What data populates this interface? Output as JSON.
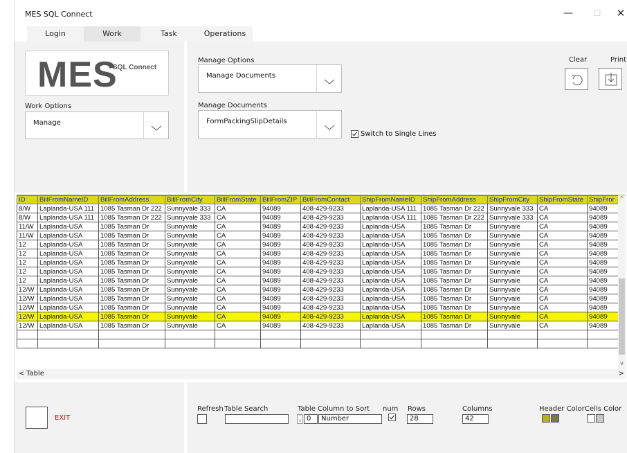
{
  "window": {
    "title": "MES SQL Connect",
    "min_label": "—",
    "max_label": "☐",
    "close_label": "✕"
  },
  "tabs": [
    {
      "label": "Login"
    },
    {
      "label": "Work"
    },
    {
      "label": "Task"
    },
    {
      "label": "Operations"
    }
  ],
  "logo": {
    "big": "MES",
    "small": "SQL Connect"
  },
  "work_options": {
    "label": "Work Options",
    "value": "Manage"
  },
  "manage_options": {
    "label": "Manage Options",
    "value": "Manage Documents"
  },
  "manage_documents": {
    "label": "Manage Documents",
    "value": "FormPackingSlipDetails"
  },
  "single_lines": {
    "label": "Switch to Single Lines",
    "checked": true
  },
  "toolbar": {
    "clear_label": "Clear",
    "print_label": "Print"
  },
  "grid": {
    "columns": [
      "ID",
      "BillFromNameID",
      "BillFromAddress",
      "BillFromCity",
      "BillFromState",
      "BillFromZIP",
      "BillFromContact",
      "ShipFromNameID",
      "ShipFromAddress",
      "ShipFromCity",
      "ShipFromState",
      "ShipFror"
    ],
    "rows": [
      [
        "8/W",
        "Laplanda-USA 111",
        "1085 Tasman Dr 222",
        "Sunnyvale 333",
        "CA",
        "94089",
        "408-429-9233",
        "Laplanda-USA 111",
        "1085 Tasman Dr 222",
        "Sunnyvale 333",
        "CA",
        "94089"
      ],
      [
        "8/W",
        "Laplanda-USA 111",
        "1085 Tasman Dr 222",
        "Sunnyvale 333",
        "CA",
        "94089",
        "408-429-9233",
        "Laplanda-USA 111",
        "1085 Tasman Dr 222",
        "Sunnyvale 333",
        "CA",
        "94089"
      ],
      [
        "11/W",
        "Laplanda-USA",
        "1085 Tasman Dr",
        "Sunnyvale",
        "CA",
        "94089",
        "408-429-9233",
        "Laplanda-USA",
        "1085 Tasman Dr",
        "Sunnyvale",
        "CA",
        "94089"
      ],
      [
        "11/W",
        "Laplanda-USA",
        "1085 Tasman Dr",
        "Sunnyvale",
        "CA",
        "94089",
        "408-429-9233",
        "Laplanda-USA",
        "1085 Tasman Dr",
        "Sunnyvale",
        "CA",
        "94089"
      ],
      [
        "12",
        "Laplanda-USA",
        "1085 Tasman Dr",
        "Sunnyvale",
        "CA",
        "94089",
        "408-429-9233",
        "Laplanda-USA",
        "1085 Tasman Dr",
        "Sunnyvale",
        "CA",
        "94089"
      ],
      [
        "12",
        "Laplanda-USA",
        "1085 Tasman Dr",
        "Sunnyvale",
        "CA",
        "94089",
        "408-429-9233",
        "Laplanda-USA",
        "1085 Tasman Dr",
        "Sunnyvale",
        "CA",
        "94089"
      ],
      [
        "12",
        "Laplanda-USA",
        "1085 Tasman Dr",
        "Sunnyvale",
        "CA",
        "94089",
        "408-429-9233",
        "Laplanda-USA",
        "1085 Tasman Dr",
        "Sunnyvale",
        "CA",
        "94089"
      ],
      [
        "12",
        "Laplanda-USA",
        "1085 Tasman Dr",
        "Sunnyvale",
        "CA",
        "94089",
        "408-429-9233",
        "Laplanda-USA",
        "1085 Tasman Dr",
        "Sunnyvale",
        "CA",
        "94089"
      ],
      [
        "12",
        "Laplanda-USA",
        "1085 Tasman Dr",
        "Sunnyvale",
        "CA",
        "94089",
        "408-429-9233",
        "Laplanda-USA",
        "1085 Tasman Dr",
        "Sunnyvale",
        "CA",
        "94089"
      ],
      [
        "12/W",
        "Laplanda-USA",
        "1085 Tasman Dr",
        "Sunnyvale",
        "CA",
        "94089",
        "408-429-9233",
        "Laplanda-USA",
        "1085 Tasman Dr",
        "Sunnyvale",
        "CA",
        "94089"
      ],
      [
        "12/W",
        "Laplanda-USA",
        "1085 Tasman Dr",
        "Sunnyvale",
        "CA",
        "94089",
        "408-429-9233",
        "Laplanda-USA",
        "1085 Tasman Dr",
        "Sunnyvale",
        "CA",
        "94089"
      ],
      [
        "12/W",
        "Laplanda-USA",
        "1085 Tasman Dr",
        "Sunnyvale",
        "CA",
        "94089",
        "408-429-9233",
        "Laplanda-USA",
        "1085 Tasman Dr",
        "Sunnyvale",
        "CA",
        "94089"
      ],
      [
        "12/W",
        "Laplanda-USA",
        "1085 Tasman Dr",
        "Sunnyvale",
        "CA",
        "94089",
        "408-429-9233",
        "Laplanda-USA",
        "1085 Tasman Dr",
        "Sunnyvale",
        "CA",
        "94089"
      ],
      [
        "12/W",
        "Laplanda-USA",
        "1085 Tasman Dr",
        "Sunnyvale",
        "CA",
        "94089",
        "408-429-9233",
        "Laplanda-USA",
        "1085 Tasman Dr",
        "Sunnyvale",
        "CA",
        "94089"
      ]
    ],
    "selected_row": 12,
    "empty_rows": 2,
    "table_label": "Table",
    "header_color": "#d9d91a",
    "selected_color": "#f5f500"
  },
  "bottom": {
    "exit_label": "EXIT",
    "refresh_label": "Refresh",
    "table_search_label": "Table Search",
    "table_search_value": "",
    "sort_label": "Table Column to Sort",
    "sort_index": "0",
    "sort_value": "Number",
    "num_label": "num",
    "num_checked": true,
    "rows_label": "Rows",
    "rows_value": "28",
    "columns_label": "Columns",
    "columns_value": "42",
    "header_color_label": "Header Color",
    "cells_color_label": "Cells Color",
    "header_swatches": [
      "#b5b814",
      "#7a7a3a"
    ],
    "cells_swatches": [
      "#ffffff",
      "#c8c8c8"
    ]
  }
}
